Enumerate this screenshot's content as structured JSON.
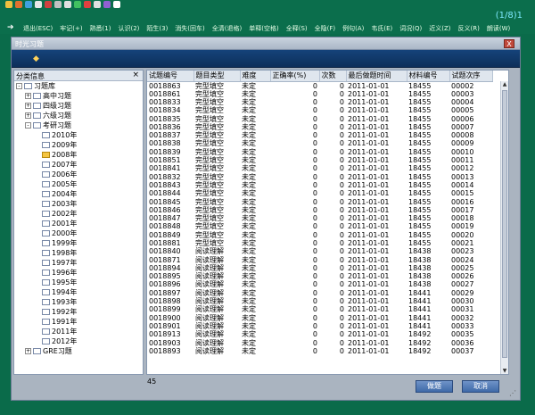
{
  "toolbar": {
    "icons": [
      "open-icon",
      "gear-icon",
      "refresh-icon",
      "doc-icon",
      "edit-icon",
      "cut-icon",
      "first-icon",
      "play-icon",
      "stop-icon",
      "last-icon",
      "settings-icon",
      "pointer-icon"
    ],
    "page_count": "(1/8)1",
    "menu_items": [
      "退出(ESC)",
      "牢记(+)",
      "熟悉(1)",
      "认识(2)",
      "陌生(3)",
      "消失(回车)",
      "全清(退格)",
      "单释(空格)",
      "全释(S)",
      "全隐(F)",
      "例句(A)",
      "韦氏(E)",
      "词况(Q)",
      "近义(Z)",
      "反义(R)",
      "朗读(W)"
    ]
  },
  "dialog": {
    "title": "时光习题",
    "close": "X",
    "tree_header": "分类信息",
    "tree_close": "×",
    "tree": [
      {
        "label": "习题库",
        "level": 0,
        "toggle": "-"
      },
      {
        "label": "高中习题",
        "level": 1,
        "toggle": "+"
      },
      {
        "label": "四级习题",
        "level": 1,
        "toggle": "+"
      },
      {
        "label": "六级习题",
        "level": 1,
        "toggle": "+"
      },
      {
        "label": "考研习题",
        "level": 1,
        "toggle": "-"
      },
      {
        "label": "2010年",
        "level": 2
      },
      {
        "label": "2009年",
        "level": 2
      },
      {
        "label": "2008年",
        "level": 2,
        "selected": true
      },
      {
        "label": "2007年",
        "level": 2
      },
      {
        "label": "2006年",
        "level": 2
      },
      {
        "label": "2005年",
        "level": 2
      },
      {
        "label": "2004年",
        "level": 2
      },
      {
        "label": "2003年",
        "level": 2
      },
      {
        "label": "2002年",
        "level": 2
      },
      {
        "label": "2001年",
        "level": 2
      },
      {
        "label": "2000年",
        "level": 2
      },
      {
        "label": "1999年",
        "level": 2
      },
      {
        "label": "1998年",
        "level": 2
      },
      {
        "label": "1997年",
        "level": 2
      },
      {
        "label": "1996年",
        "level": 2
      },
      {
        "label": "1995年",
        "level": 2
      },
      {
        "label": "1994年",
        "level": 2
      },
      {
        "label": "1993年",
        "level": 2
      },
      {
        "label": "1992年",
        "level": 2
      },
      {
        "label": "1991年",
        "level": 2
      },
      {
        "label": "2011年",
        "level": 2
      },
      {
        "label": "2012年",
        "level": 2
      },
      {
        "label": "GRE习题",
        "level": 1,
        "toggle": "+"
      }
    ],
    "columns": [
      "试题编号",
      "题目类型",
      "难度",
      "正确率(%)",
      "次数",
      "最后做题时间",
      "材料编号",
      "试题次序"
    ],
    "rows": [
      [
        "0018863",
        "完型填空",
        "未定",
        "0",
        "0",
        "2011-01-01",
        "18455",
        "00002"
      ],
      [
        "0018861",
        "完型填空",
        "未定",
        "0",
        "0",
        "2011-01-01",
        "18455",
        "00003"
      ],
      [
        "0018833",
        "完型填空",
        "未定",
        "0",
        "0",
        "2011-01-01",
        "18455",
        "00004"
      ],
      [
        "0018834",
        "完型填空",
        "未定",
        "0",
        "0",
        "2011-01-01",
        "18455",
        "00005"
      ],
      [
        "0018835",
        "完型填空",
        "未定",
        "0",
        "0",
        "2011-01-01",
        "18455",
        "00006"
      ],
      [
        "0018836",
        "完型填空",
        "未定",
        "0",
        "0",
        "2011-01-01",
        "18455",
        "00007"
      ],
      [
        "0018837",
        "完型填空",
        "未定",
        "0",
        "0",
        "2011-01-01",
        "18455",
        "00008"
      ],
      [
        "0018838",
        "完型填空",
        "未定",
        "0",
        "0",
        "2011-01-01",
        "18455",
        "00009"
      ],
      [
        "0018839",
        "完型填空",
        "未定",
        "0",
        "0",
        "2011-01-01",
        "18455",
        "00010"
      ],
      [
        "0018851",
        "完型填空",
        "未定",
        "0",
        "0",
        "2011-01-01",
        "18455",
        "00011"
      ],
      [
        "0018841",
        "完型填空",
        "未定",
        "0",
        "0",
        "2011-01-01",
        "18455",
        "00012"
      ],
      [
        "0018832",
        "完型填空",
        "未定",
        "0",
        "0",
        "2011-01-01",
        "18455",
        "00013"
      ],
      [
        "0018843",
        "完型填空",
        "未定",
        "0",
        "0",
        "2011-01-01",
        "18455",
        "00014"
      ],
      [
        "0018844",
        "完型填空",
        "未定",
        "0",
        "0",
        "2011-01-01",
        "18455",
        "00015"
      ],
      [
        "0018845",
        "完型填空",
        "未定",
        "0",
        "0",
        "2011-01-01",
        "18455",
        "00016"
      ],
      [
        "0018846",
        "完型填空",
        "未定",
        "0",
        "0",
        "2011-01-01",
        "18455",
        "00017"
      ],
      [
        "0018847",
        "完型填空",
        "未定",
        "0",
        "0",
        "2011-01-01",
        "18455",
        "00018"
      ],
      [
        "0018848",
        "完型填空",
        "未定",
        "0",
        "0",
        "2011-01-01",
        "18455",
        "00019"
      ],
      [
        "0018849",
        "完型填空",
        "未定",
        "0",
        "0",
        "2011-01-01",
        "18455",
        "00020"
      ],
      [
        "0018881",
        "完型填空",
        "未定",
        "0",
        "0",
        "2011-01-01",
        "18455",
        "00021"
      ],
      [
        "0018840",
        "阅读理解",
        "未定",
        "0",
        "0",
        "2011-01-01",
        "18438",
        "00023"
      ],
      [
        "0018871",
        "阅读理解",
        "未定",
        "0",
        "0",
        "2011-01-01",
        "18438",
        "00024"
      ],
      [
        "0018894",
        "阅读理解",
        "未定",
        "0",
        "0",
        "2011-01-01",
        "18438",
        "00025"
      ],
      [
        "0018895",
        "阅读理解",
        "未定",
        "0",
        "0",
        "2011-01-01",
        "18438",
        "00026"
      ],
      [
        "0018896",
        "阅读理解",
        "未定",
        "0",
        "0",
        "2011-01-01",
        "18438",
        "00027"
      ],
      [
        "0018897",
        "阅读理解",
        "未定",
        "0",
        "0",
        "2011-01-01",
        "18441",
        "00029"
      ],
      [
        "0018898",
        "阅读理解",
        "未定",
        "0",
        "0",
        "2011-01-01",
        "18441",
        "00030"
      ],
      [
        "0018899",
        "阅读理解",
        "未定",
        "0",
        "0",
        "2011-01-01",
        "18441",
        "00031"
      ],
      [
        "0018900",
        "阅读理解",
        "未定",
        "0",
        "0",
        "2011-01-01",
        "18441",
        "00032"
      ],
      [
        "0018901",
        "阅读理解",
        "未定",
        "0",
        "0",
        "2011-01-01",
        "18441",
        "00033"
      ],
      [
        "0018913",
        "阅读理解",
        "未定",
        "0",
        "0",
        "2011-01-01",
        "18492",
        "00035"
      ],
      [
        "0018903",
        "阅读理解",
        "未定",
        "0",
        "0",
        "2011-01-01",
        "18492",
        "00036"
      ],
      [
        "0018893",
        "阅读理解",
        "未定",
        "0",
        "0",
        "2011-01-01",
        "18492",
        "00037"
      ]
    ],
    "count": "45",
    "ok_label": "做题",
    "cancel_label": "取消"
  }
}
